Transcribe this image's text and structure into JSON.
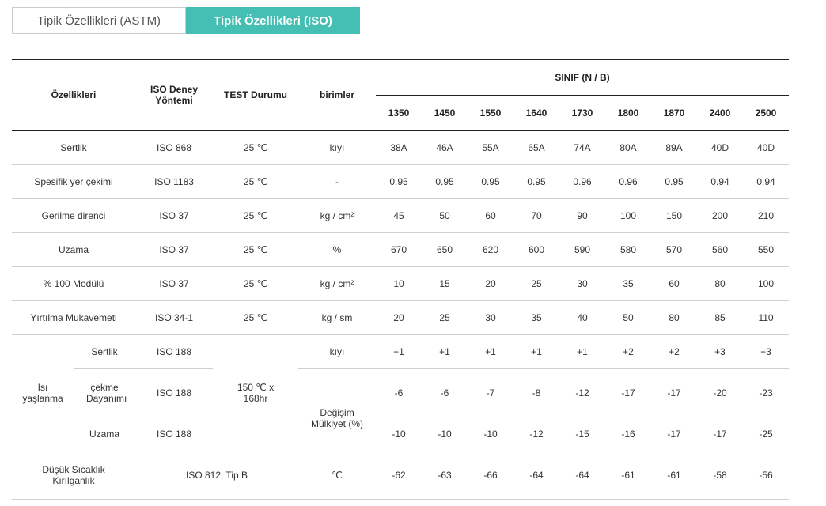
{
  "tabs": {
    "astm": "Tipik Özellikleri (ASTM)",
    "iso": "Tipik Özellikleri (ISO)"
  },
  "header": {
    "properties": "Özellikleri",
    "method": "ISO Deney Yöntemi",
    "test": "TEST Durumu",
    "units": "birimler",
    "sinif": "SINIF (N / B)",
    "grades": [
      "1350",
      "1450",
      "1550",
      "1640",
      "1730",
      "1800",
      "1870",
      "2400",
      "2500"
    ]
  },
  "rows": [
    {
      "name": "Sertlik",
      "method": "ISO 868",
      "test": "25 ℃",
      "unit": "kıyı",
      "values": [
        "38A",
        "46A",
        "55A",
        "65A",
        "74A",
        "80A",
        "89A",
        "40D",
        "40D"
      ]
    },
    {
      "name": "Spesifik yer çekimi",
      "method": "ISO 1183",
      "test": "25 ℃",
      "unit": "-",
      "values": [
        "0.95",
        "0.95",
        "0.95",
        "0.95",
        "0.96",
        "0.96",
        "0.95",
        "0.94",
        "0.94"
      ]
    },
    {
      "name": "Gerilme direnci",
      "method": "ISO 37",
      "test": "25 ℃",
      "unit": "kg / cm²",
      "values": [
        "45",
        "50",
        "60",
        "70",
        "90",
        "100",
        "150",
        "200",
        "210"
      ]
    },
    {
      "name": "Uzama",
      "method": "ISO 37",
      "test": "25 ℃",
      "unit": "%",
      "values": [
        "670",
        "650",
        "620",
        "600",
        "590",
        "580",
        "570",
        "560",
        "550"
      ]
    },
    {
      "name": "% 100 Modülü",
      "method": "ISO 37",
      "test": "25 ℃",
      "unit": "kg / cm²",
      "values": [
        "10",
        "15",
        "20",
        "25",
        "30",
        "35",
        "60",
        "80",
        "100"
      ]
    },
    {
      "name": "Yırtılma Mukavemeti",
      "method": "ISO 34-1",
      "test": "25 ℃",
      "unit": "kg / sm",
      "values": [
        "20",
        "25",
        "30",
        "35",
        "40",
        "50",
        "80",
        "85",
        "110"
      ]
    }
  ],
  "aging": {
    "group": "Isı yaşlanma",
    "test": "150 ℃ x 168hr",
    "unit_change": "Değişim Mülkiyet (%)",
    "subrows": [
      {
        "name": "Sertlik",
        "method": "ISO 188",
        "unit": "kıyı",
        "values": [
          "+1",
          "+1",
          "+1",
          "+1",
          "+1",
          "+2",
          "+2",
          "+3",
          "+3"
        ]
      },
      {
        "name": "çekme Dayanımı",
        "method": "ISO 188",
        "values": [
          "-6",
          "-6",
          "-7",
          "-8",
          "-12",
          "-17",
          "-17",
          "-20",
          "-23"
        ]
      },
      {
        "name": "Uzama",
        "method": "ISO 188",
        "values": [
          "-10",
          "-10",
          "-10",
          "-12",
          "-15",
          "-16",
          "-17",
          "-17",
          "-25"
        ]
      }
    ]
  },
  "lowtemp": {
    "name": "Düşük Sıcaklık Kırılganlık",
    "method": "ISO 812, Tip B",
    "unit": "℃",
    "values": [
      "-62",
      "-63",
      "-66",
      "-64",
      "-64",
      "-61",
      "-61",
      "-58",
      "-56"
    ]
  }
}
